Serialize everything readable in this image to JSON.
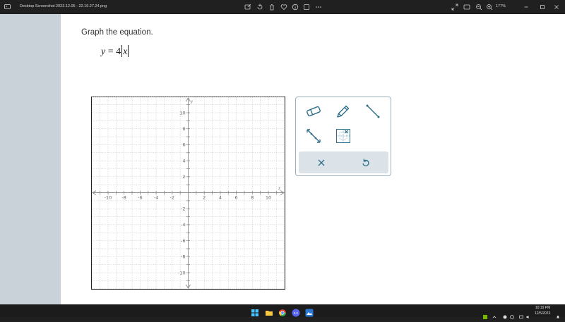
{
  "window": {
    "title": "Desktop Screenshot 2023.12.05 - 22.19.27.24.png",
    "zoom": "177%"
  },
  "question": {
    "prompt": "Graph the equation.",
    "equation_lhs": "y",
    "equation_eq": "=",
    "equation_coef": "4",
    "equation_var": "x"
  },
  "graph": {
    "x_axis_label": "x",
    "y_axis_label": "y",
    "x_range": [
      -12,
      12
    ],
    "y_range": [
      -12,
      12
    ],
    "grid": true,
    "tick_labels_x": [
      "-10",
      "-8",
      "-6",
      "-4",
      "-2",
      "2",
      "4",
      "6",
      "8",
      "10"
    ],
    "tick_labels_y": [
      "10",
      "8",
      "6",
      "4",
      "2",
      "-2",
      "-4",
      "-6",
      "-8",
      "-10"
    ]
  },
  "tools": {
    "items": [
      "eraser-icon",
      "pencil-icon",
      "line-segment-icon",
      "line-icon",
      "point-grid-icon"
    ],
    "actions": [
      "clear-icon",
      "undo-icon"
    ],
    "accent": "#2f6f89"
  },
  "taskbar": {
    "time": "10:19 PM",
    "date": "12/5/2023"
  }
}
